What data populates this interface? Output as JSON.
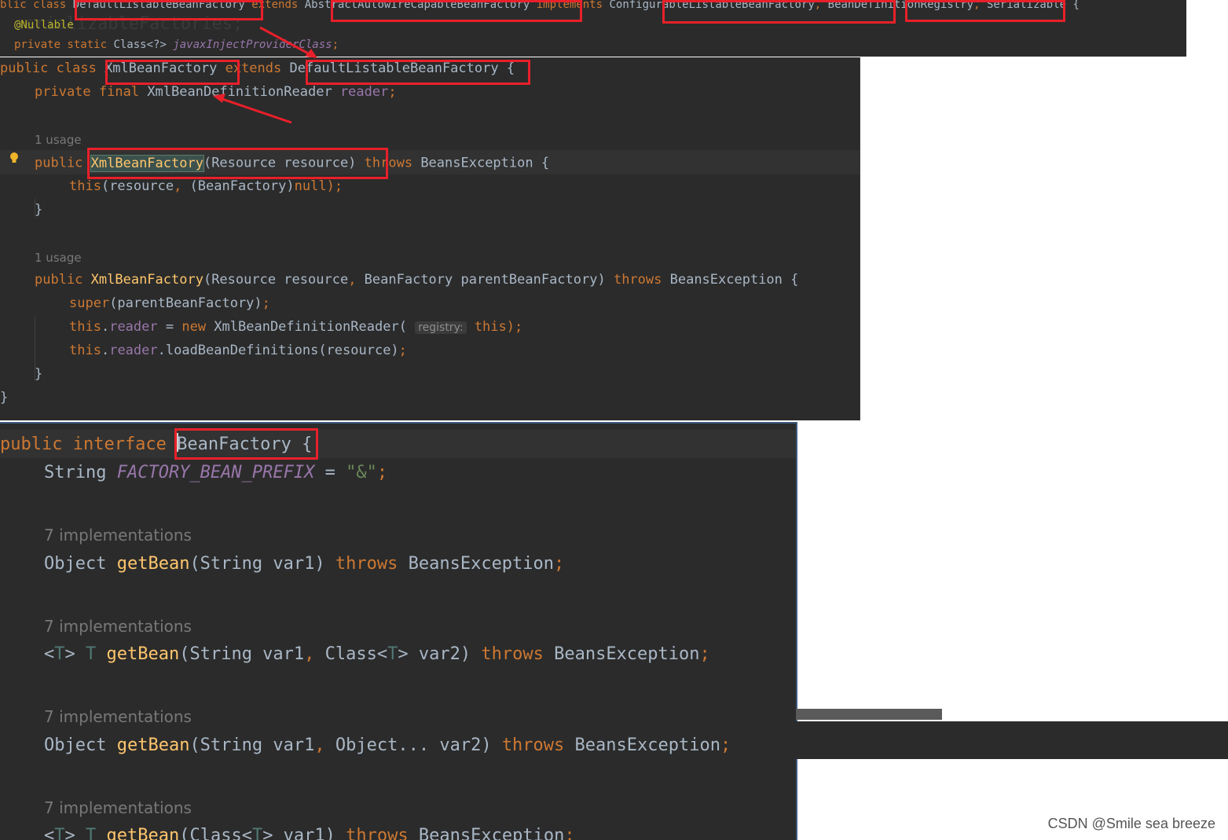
{
  "top_panel": {
    "line1": {
      "p1": "blic class ",
      "cls": "DefaultListableBeanFactory",
      "p2": " extends ",
      "sup": "AbstractAutowireCapableBeanFactory",
      "p3": " implements ",
      "i1": "ConfigurableListableBeanFactory",
      "comma1": ",",
      "i2": "BeanDefinitionRegistry",
      "comma2": ",",
      "i3": " Serializable {"
    },
    "ghost": "serializableFactories;",
    "annotation": "@Nullable",
    "line3": {
      "kw": "private static ",
      "type": "Class<?> ",
      "field": "javaxInjectProviderClass",
      "end": ";"
    }
  },
  "middle_panel": {
    "class_decl": {
      "kw": "public class ",
      "name": "XmlBeanFactory",
      "ext": " extends ",
      "parent": "DefaultListableBeanFactory",
      "brace": " {"
    },
    "field_decl": {
      "kw": "private final ",
      "type": "XmlBeanDefinitionReader ",
      "name": "reader",
      "end": ";"
    },
    "usage1": "1 usage",
    "ctor1": {
      "kw": "public ",
      "name": "XmlBeanFactory",
      "params": "(Resource resource) ",
      "throws": "throws",
      "exc": " BeansException {"
    },
    "ctor1_body": {
      "this": "this",
      "args1": "(resource",
      "comma": ",",
      "args2": " (BeanFactory)",
      "null": "null",
      "end": ");"
    },
    "close1": "}",
    "usage2": "1 usage",
    "ctor2": {
      "kw": "public ",
      "name": "XmlBeanFactory",
      "p1": "(Resource resource",
      "comma": ",",
      "p2": " BeanFactory parentBeanFactory) ",
      "throws": "throws",
      "exc": " BeansException {"
    },
    "super_line": {
      "kw": "super",
      "args": "(parentBeanFactory)",
      "end": ";"
    },
    "reader_line": {
      "this": "this",
      "dot": ".",
      "field": "reader",
      "eq": " = ",
      "new": "new",
      "type": " XmlBeanDefinitionReader(",
      "hint": "registry:",
      "this2": "this",
      "end": ");"
    },
    "load_line": {
      "this": "this",
      "dot": ".",
      "field": "reader",
      "call": ".loadBeanDefinitions(resource)",
      "end": ";"
    },
    "close2": "}",
    "close3": "}"
  },
  "bottom_panel": {
    "decl": {
      "kw": "public interface ",
      "name": "BeanFactory",
      "brace": " {"
    },
    "const": {
      "type": "String ",
      "name": "FACTORY_BEAN_PREFIX",
      "eq": " = ",
      "val": "\"&\"",
      "end": ";"
    },
    "impl_label": "7 implementations",
    "m1": {
      "ret": "Object ",
      "name": "getBean",
      "params": "(String var1) ",
      "throws": "throws",
      "exc": " BeansException",
      "end": ";"
    },
    "m2": {
      "lt": "<",
      "T": "T",
      "gt": "> ",
      "ret": "T",
      "sp": " ",
      "name": "getBean",
      "p1": "(String var1",
      "comma": ",",
      "p2": " Class<",
      "T2": "T",
      "p3": "> var2) ",
      "throws": "throws",
      "exc": " BeansException",
      "end": ";"
    },
    "m3": {
      "ret": "Object ",
      "name": "getBean",
      "p1": "(String var1",
      "comma": ",",
      "p2": " Object... var2) ",
      "throws": "throws",
      "exc": " BeansException",
      "end": ";"
    },
    "m4": {
      "lt": "<",
      "T": "T",
      "gt": "> ",
      "ret": "T",
      "sp": " ",
      "name": "getBean",
      "p1": "(Class<",
      "T2": "T",
      "p2": "> var1) ",
      "throws": "throws",
      "exc": " BeansException",
      "end": ";"
    }
  },
  "watermark": "CSDN @Smile sea breeze",
  "colors": {
    "editor_bg": "#2b2b2b",
    "keyword": "#cc7832",
    "text": "#a9b7c6",
    "method": "#ffc66d",
    "field": "#9876aa",
    "string": "#6a8759",
    "highlight_box": "#e8202a"
  }
}
